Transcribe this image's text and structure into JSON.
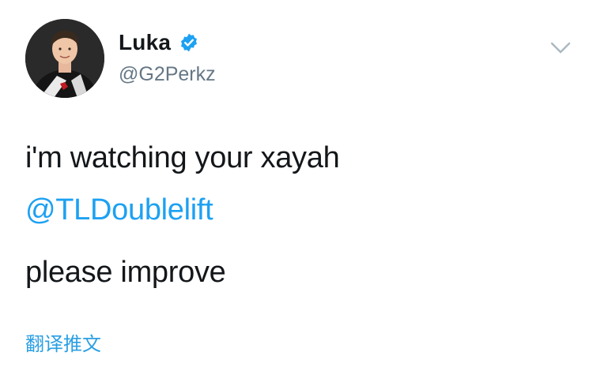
{
  "tweet": {
    "author": {
      "display_name": "Luka",
      "handle": "@G2Perkz",
      "verified": true,
      "avatar_icon": "avatar-photo"
    },
    "lines": {
      "line1": "i'm watching your xayah",
      "line2": "@TLDoublelift",
      "line3": "please improve"
    },
    "translate_label": "翻译推文",
    "menu_icon": "chevron-down-icon"
  },
  "colors": {
    "link": "#2b9fe2",
    "verified": "#1da1f2",
    "handle": "#657786",
    "text": "#14171a",
    "background": "#ffffff"
  }
}
